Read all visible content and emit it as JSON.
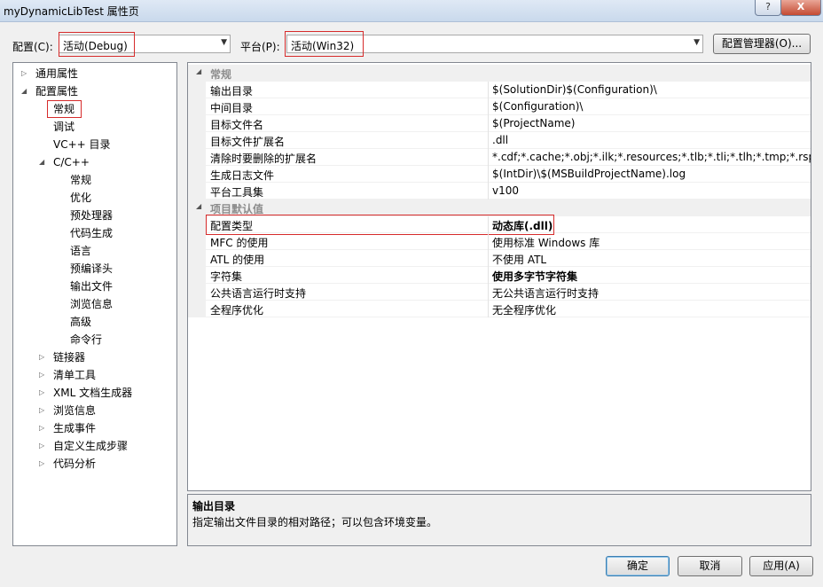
{
  "window": {
    "title": "myDynamicLibTest 属性页",
    "help_glyph": "?",
    "close_glyph": "X"
  },
  "toolbar": {
    "config_label": "配置(C):",
    "config_value": "活动(Debug)",
    "platform_label": "平台(P):",
    "platform_value": "活动(Win32)",
    "config_manager_label": "配置管理器(O)..."
  },
  "tree": [
    {
      "label": "通用属性",
      "level": 0,
      "toggle": "collapsed"
    },
    {
      "label": "配置属性",
      "level": 0,
      "toggle": "expanded"
    },
    {
      "label": "常规",
      "level": 1,
      "toggle": "none",
      "selected": true
    },
    {
      "label": "调试",
      "level": 1,
      "toggle": "none"
    },
    {
      "label": "VC++ 目录",
      "level": 1,
      "toggle": "none"
    },
    {
      "label": "C/C++",
      "level": 1,
      "toggle": "expanded"
    },
    {
      "label": "常规",
      "level": 2,
      "toggle": "none"
    },
    {
      "label": "优化",
      "level": 2,
      "toggle": "none"
    },
    {
      "label": "预处理器",
      "level": 2,
      "toggle": "none"
    },
    {
      "label": "代码生成",
      "level": 2,
      "toggle": "none"
    },
    {
      "label": "语言",
      "level": 2,
      "toggle": "none"
    },
    {
      "label": "预编译头",
      "level": 2,
      "toggle": "none"
    },
    {
      "label": "输出文件",
      "level": 2,
      "toggle": "none"
    },
    {
      "label": "浏览信息",
      "level": 2,
      "toggle": "none"
    },
    {
      "label": "高级",
      "level": 2,
      "toggle": "none"
    },
    {
      "label": "命令行",
      "level": 2,
      "toggle": "none"
    },
    {
      "label": "链接器",
      "level": 1,
      "toggle": "collapsed"
    },
    {
      "label": "清单工具",
      "level": 1,
      "toggle": "collapsed"
    },
    {
      "label": "XML 文档生成器",
      "level": 1,
      "toggle": "collapsed"
    },
    {
      "label": "浏览信息",
      "level": 1,
      "toggle": "collapsed"
    },
    {
      "label": "生成事件",
      "level": 1,
      "toggle": "collapsed"
    },
    {
      "label": "自定义生成步骤",
      "level": 1,
      "toggle": "collapsed"
    },
    {
      "label": "代码分析",
      "level": 1,
      "toggle": "collapsed"
    }
  ],
  "grid": {
    "categories": [
      {
        "name": "常规",
        "rows": [
          {
            "name": "输出目录",
            "value": "$(SolutionDir)$(Configuration)\\"
          },
          {
            "name": "中间目录",
            "value": "$(Configuration)\\"
          },
          {
            "name": "目标文件名",
            "value": "$(ProjectName)"
          },
          {
            "name": "目标文件扩展名",
            "value": ".dll"
          },
          {
            "name": "清除时要删除的扩展名",
            "value": "*.cdf;*.cache;*.obj;*.ilk;*.resources;*.tlb;*.tli;*.tlh;*.tmp;*.rsp;*.pgc"
          },
          {
            "name": "生成日志文件",
            "value": "$(IntDir)\\$(MSBuildProjectName).log"
          },
          {
            "name": "平台工具集",
            "value": "v100"
          }
        ]
      },
      {
        "name": "项目默认值",
        "rows": [
          {
            "name": "配置类型",
            "value": "动态库(.dll)",
            "bold": true
          },
          {
            "name": "MFC 的使用",
            "value": "使用标准 Windows 库"
          },
          {
            "name": "ATL 的使用",
            "value": "不使用 ATL"
          },
          {
            "name": "字符集",
            "value": "使用多字节字符集",
            "bold": true
          },
          {
            "name": "公共语言运行时支持",
            "value": "无公共语言运行时支持"
          },
          {
            "name": "全程序优化",
            "value": "无全程序优化"
          }
        ]
      }
    ]
  },
  "description": {
    "title": "输出目录",
    "text": "指定输出文件目录的相对路径；可以包含环境变量。"
  },
  "buttons": {
    "ok": "确定",
    "cancel": "取消",
    "apply": "应用(A)"
  },
  "icons": {
    "combo_arrow": "▼",
    "tree_collapsed": "▷",
    "tree_expanded": "◢",
    "category_expanded": "◢"
  },
  "colors": {
    "highlight_box": "#d62b2b"
  }
}
